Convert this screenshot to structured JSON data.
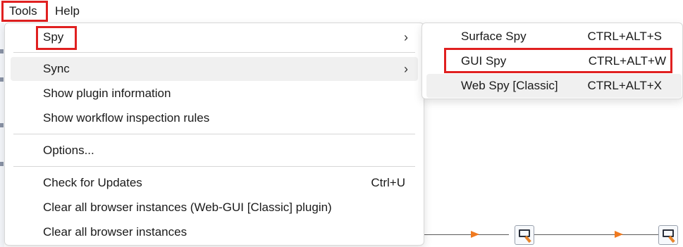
{
  "menubar": {
    "tools_label": "Tools",
    "help_label": "Help"
  },
  "tools_menu": {
    "items": [
      {
        "label": "Spy",
        "submenu_icon": "chevron-right-icon"
      },
      {
        "label": "Sync",
        "submenu_icon": "chevron-right-icon"
      },
      {
        "label": "Show plugin information"
      },
      {
        "label": "Show workflow inspection rules"
      },
      {
        "label": "Options..."
      },
      {
        "label": "Check for Updates",
        "shortcut": "Ctrl+U"
      },
      {
        "label": "Clear all browser instances (Web-GUI [Classic] plugin)"
      },
      {
        "label": "Clear all browser instances"
      }
    ],
    "chevron_glyph": "›"
  },
  "spy_submenu": {
    "items": [
      {
        "label": "Surface Spy",
        "shortcut": "CTRL+ALT+S"
      },
      {
        "label": "GUI Spy",
        "shortcut": "CTRL+ALT+W"
      },
      {
        "label": "Web Spy [Classic]",
        "shortcut": "CTRL+ALT+X"
      }
    ]
  },
  "colors": {
    "highlight_box": "#e02020",
    "hover_bg": "#f0f0f0",
    "arrow": "#f07a20"
  }
}
